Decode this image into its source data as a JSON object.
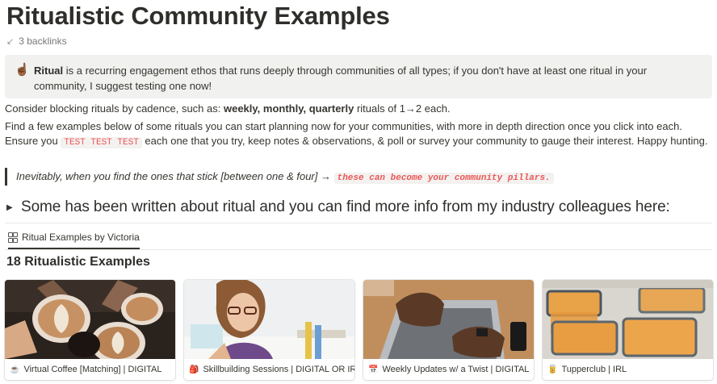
{
  "page": {
    "title": "Ritualistic Community Examples",
    "backlinks": "3 backlinks"
  },
  "callout": {
    "emoji": "☝🏾",
    "bold": "Ritual",
    "text": " is a recurring engagement ethos that runs deeply through communities of all types; if you don't have at least one ritual in your community, I suggest testing one now!"
  },
  "para1": {
    "before": "Consider blocking rituals by cadence, such as: ",
    "bold": "weekly, monthly, quarterly",
    "after": " rituals of 1→2 each."
  },
  "para2": {
    "before": "Find a few examples below of some rituals you can start planning now for your communities, with more in depth direction once you click into each. Ensure you ",
    "code": "TEST TEST TEST",
    "after": " each one that you try, keep notes & observations, & poll or survey your community to gauge their interest. Happy hunting."
  },
  "quote": {
    "text": "Inevitably, when you find the ones that stick [between one & four] → ",
    "code": "these can become your community pillars."
  },
  "toggle": {
    "label": "Some has been written about ritual and you can find more info from my industry colleagues here:"
  },
  "view_tab": {
    "label": "Ritual Examples by Victoria",
    "icon": "gallery-icon"
  },
  "section_title": "18 Ritualistic Examples",
  "cards": [
    {
      "label": "Virtual Coffee [Matching] | DIGITAL",
      "icon": "coffee-icon",
      "glyph": "☕"
    },
    {
      "label": "Skillbuilding Sessions | DIGITAL OR IRL",
      "icon": "backpack-icon",
      "glyph": "🎒"
    },
    {
      "label": "Weekly Updates w/ a Twist | DIGITAL",
      "icon": "calendar-icon",
      "glyph": "📅"
    },
    {
      "label": "Tupperclub | IRL",
      "icon": "can-icon",
      "glyph": "🥫"
    }
  ]
}
